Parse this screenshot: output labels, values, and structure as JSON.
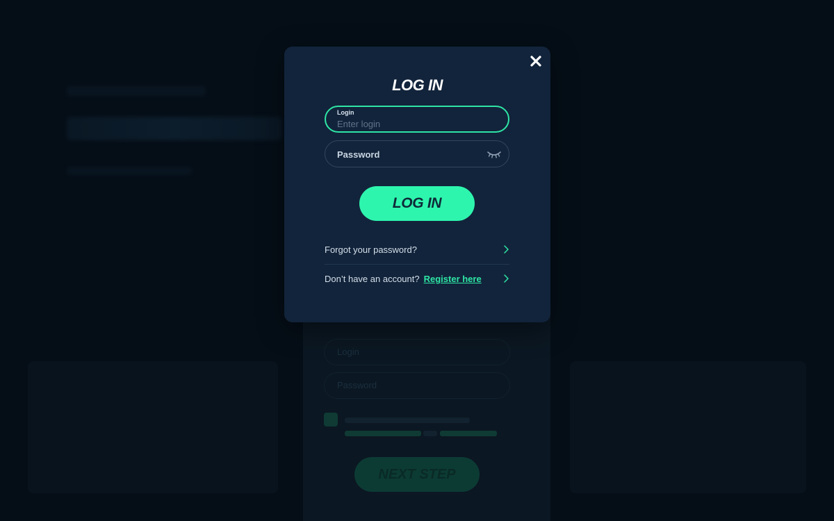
{
  "modal": {
    "title": "LOG IN",
    "close_icon": "close-icon",
    "login_field": {
      "label": "Login",
      "placeholder": "Enter login"
    },
    "password_field": {
      "placeholder": "Password",
      "icon": "eye-closed-icon"
    },
    "submit_label": "LOG IN",
    "forgot_link": "Forgot your password?",
    "no_account_text": "Don’t have an account?",
    "register_link": "Register here"
  },
  "background": {
    "next_step_label": "NEXT STEP",
    "login_placeholder": "Login",
    "password_placeholder": "Password"
  },
  "colors": {
    "accent": "#2ef5ae",
    "modal_bg": "#12243b",
    "page_bg": "#050e17"
  }
}
